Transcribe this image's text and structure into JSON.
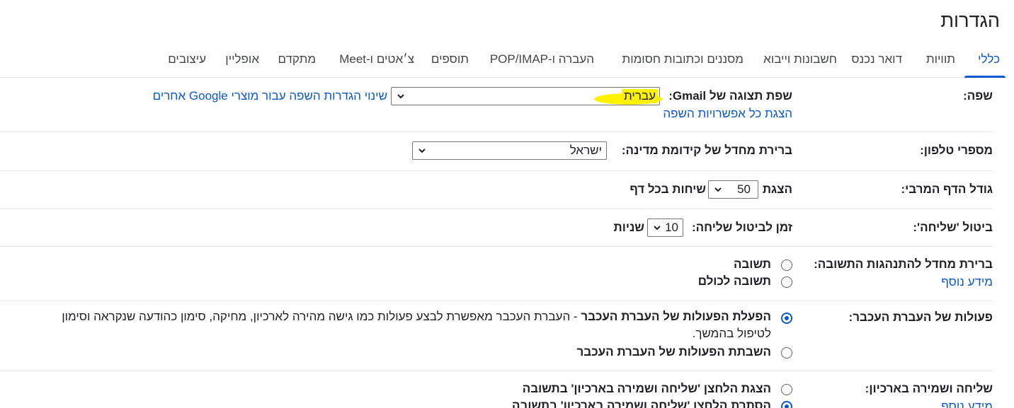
{
  "page": {
    "title": "הגדרות"
  },
  "tabs": [
    {
      "label": "כללי",
      "active": true
    },
    {
      "label": "תוויות"
    },
    {
      "label": "דואר נכנס"
    },
    {
      "label": "חשבונות וייבוא"
    },
    {
      "label": "מסננים וכתובות חסומות"
    },
    {
      "label": "העברה ו-POP/IMAP"
    },
    {
      "label": "תוספים"
    },
    {
      "label": "צ׳אטים ו-Meet"
    },
    {
      "label": "מתקדם"
    },
    {
      "label": "אופליין"
    },
    {
      "label": "עיצובים"
    }
  ],
  "language": {
    "label": "שפה:",
    "display_label": "שפת תצוגה של Gmail:",
    "selected": "עברית",
    "change_link": "שינוי הגדרות השפה עבור מוצרי Google אחרים",
    "show_all_link": "הצגת כל אפשרויות השפה"
  },
  "phone": {
    "label": "מספרי טלפון:",
    "default_label": "ברירת מחדל של קידומת מדינה:",
    "selected": "ישראל"
  },
  "page_size": {
    "label": "גודל הדף המרבי:",
    "prefix": "הצגת",
    "selected": "50",
    "suffix": "שיחות בכל דף"
  },
  "undo_send": {
    "label": "ביטול 'שליחה':",
    "prefix": "זמן לביטול שליחה:",
    "selected": "10",
    "suffix": "שניות"
  },
  "reply_behavior": {
    "label": "ברירת מחדל להתנהגות התשובה:",
    "learn_more": "מידע נוסף",
    "options": [
      {
        "label": "תשובה",
        "checked": false
      },
      {
        "label": "תשובה לכולם",
        "checked": false
      }
    ]
  },
  "hover_actions": {
    "label": "פעולות של העברת העכבר:",
    "enable_label": "הפעלת הפעולות של העברת העכבר",
    "enable_desc": " - העברת העכבר מאפשרת לבצע פעולות כמו גישה מהירה לארכיון, מחיקה, סימון כהודעה שנקראה וסימון",
    "enable_desc_cont": "לטיפול בהמשך.",
    "enabled": true,
    "disable_label": "השבתת הפעולות של העברת העכבר"
  },
  "send_archive": {
    "label": "שליחה ושמירה בארכיון:",
    "learn_more": "מידע נוסף",
    "show_label": "הצגת הלחצן 'שליחה ושמירה בארכיון' בתשובה",
    "hide_label": "הסתרת הלחצן 'שליחה ושמירה בארכיון' בתשובה",
    "hide_checked": true
  },
  "colors": {
    "accent": "#0b57d0",
    "highlight": "#fff200",
    "divider": "#e6e6e6"
  }
}
